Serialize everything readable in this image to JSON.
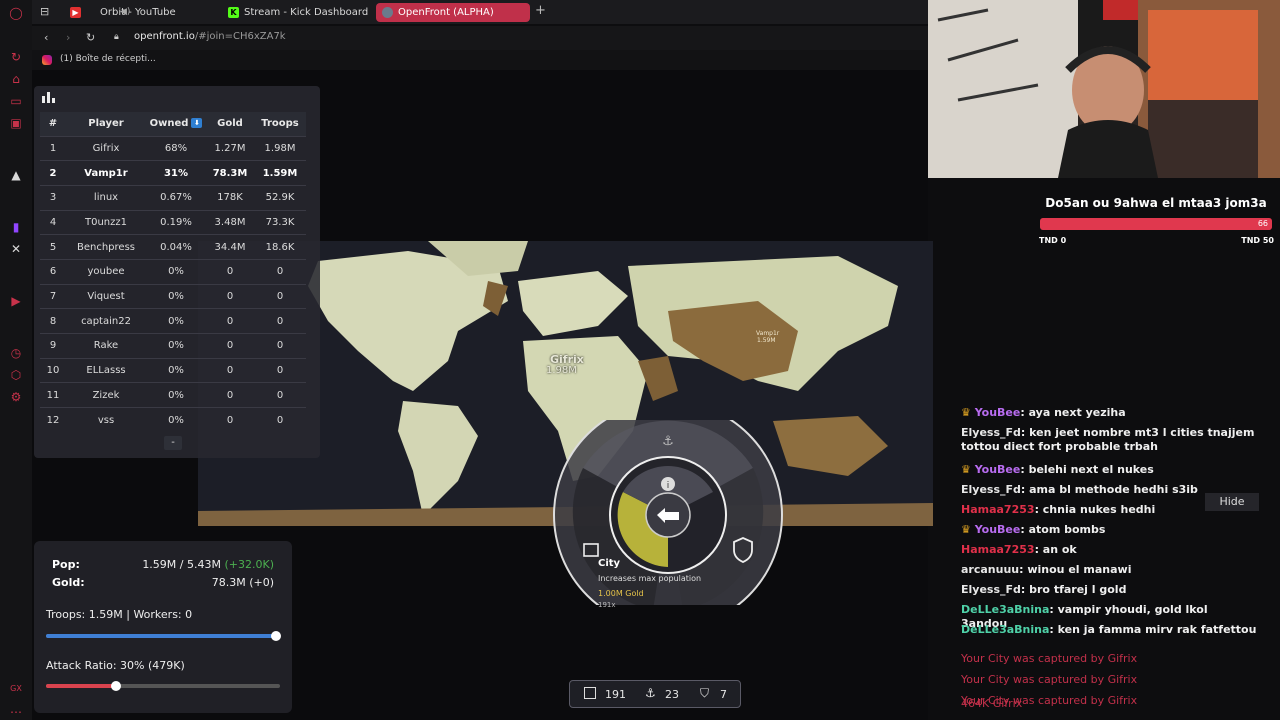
{
  "browser": {
    "tabs": [
      {
        "label": "Orbit - YouTube",
        "icon": "youtube-icon"
      },
      {
        "label": "Stream - Kick Dashboard",
        "icon": "kick-icon"
      },
      {
        "label": "OpenFront (ALPHA)",
        "icon": "globe-icon",
        "active": true
      }
    ],
    "address": "openfront.io/#join=CH6xZA7k",
    "address_host": "openfront.io",
    "address_hash": "/#join=CH6xZA7k",
    "bookmark": "(1) Boîte de récepti..."
  },
  "leaderboard": {
    "headers": [
      "#",
      "Player",
      "Owned",
      "Gold",
      "Troops"
    ],
    "sort_column": "Owned",
    "rows": [
      {
        "rank": "1",
        "player": "Gifrix",
        "owned": "68%",
        "gold": "1.27M",
        "troops": "1.98M"
      },
      {
        "rank": "2",
        "player": "Vamp1r",
        "owned": "31%",
        "gold": "78.3M",
        "troops": "1.59M",
        "me": true
      },
      {
        "rank": "3",
        "player": "linux",
        "owned": "0.67%",
        "gold": "178K",
        "troops": "52.9K"
      },
      {
        "rank": "4",
        "player": "T0unzz1",
        "owned": "0.19%",
        "gold": "3.48M",
        "troops": "73.3K"
      },
      {
        "rank": "5",
        "player": "Benchpress",
        "owned": "0.04%",
        "gold": "34.4M",
        "troops": "18.6K"
      },
      {
        "rank": "6",
        "player": "youbee",
        "owned": "0%",
        "gold": "0",
        "troops": "0"
      },
      {
        "rank": "7",
        "player": "Viquest",
        "owned": "0%",
        "gold": "0",
        "troops": "0"
      },
      {
        "rank": "8",
        "player": "captain22",
        "owned": "0%",
        "gold": "0",
        "troops": "0"
      },
      {
        "rank": "9",
        "player": "Rake",
        "owned": "0%",
        "gold": "0",
        "troops": "0"
      },
      {
        "rank": "10",
        "player": "ELLasss",
        "owned": "0%",
        "gold": "0",
        "troops": "0"
      },
      {
        "rank": "11",
        "player": "Zizek",
        "owned": "0%",
        "gold": "0",
        "troops": "0"
      },
      {
        "rank": "12",
        "player": "vss",
        "owned": "0%",
        "gold": "0",
        "troops": "0"
      }
    ],
    "collapse_label": "-"
  },
  "map_labels": {
    "gifrix_name": "Gifrix",
    "gifrix_troops": "1.98M",
    "vamp_name": "Vamp1r",
    "vamp_troops": "1.59M"
  },
  "stats": {
    "pop_label": "Pop:",
    "pop_value": "1.59M / 5.43M",
    "pop_delta": "(+32.0K)",
    "gold_label": "Gold:",
    "gold_value": "78.3M (+0)",
    "troops_line": "Troops: 1.59M | Workers: 0",
    "troop_ratio": 1.0,
    "attack_line": "Attack Ratio: 30% (479K)",
    "attack_ratio": 0.3,
    "colors": {
      "troop": "#3f7fd4",
      "attack": "#d9434e",
      "delta": "#4caf50"
    }
  },
  "radial_menu": {
    "tooltip_title": "City",
    "tooltip_desc": "Increases max population",
    "tooltip_cost": "1.00M Gold",
    "tooltip_count": "191x"
  },
  "build_bar": {
    "cities": "191",
    "ports": "23",
    "defense": "7"
  },
  "donation": {
    "title": "Do5an ou 9ahwa el mtaa3 jom3a",
    "current": 66,
    "min_label": "TND 0",
    "max_label": "TND 50",
    "bar_value": "66"
  },
  "chat": {
    "hide_label": "Hide",
    "messages": [
      {
        "user": "YouBee",
        "text": ": aya next yeziha",
        "color": "#b86cf0",
        "crown": true
      },
      {
        "user": "Elyess_Fd",
        "text": ": ken jeet nombre mt3 l cities tnajjem tottou diect fort probable trbah",
        "color": "#e8e8e8"
      },
      {
        "user": "YouBee",
        "text": ": belehi next el nukes",
        "color": "#b86cf0",
        "crown": true
      },
      {
        "user": "Elyess_Fd",
        "text": ": ama bl methode hedhi s3ib",
        "color": "#e8e8e8"
      },
      {
        "user": "Hamaa7253",
        "text": ": chnia nukes hedhi",
        "color": "#e0304a"
      },
      {
        "user": "YouBee",
        "text": ": atom bombs",
        "color": "#b86cf0",
        "crown": true
      },
      {
        "user": "Hamaa7253",
        "text": ": an ok",
        "color": "#e0304a"
      },
      {
        "user": "arcanuuu",
        "text": ": winou el manawi",
        "color": "#e8e8e8"
      },
      {
        "user": "Elyess_Fd",
        "text": ": bro tfarej l gold",
        "color": "#e8e8e8"
      },
      {
        "user": "DeLLe3aBnina",
        "text": ": vampir yhoudi, gold lkol 3andou",
        "color": "#4fd1a8"
      },
      {
        "user": "DeLLe3aBnina",
        "text": ": ken ja famma mirv rak fatfettou",
        "color": "#4fd1a8"
      }
    ],
    "game_messages": [
      "Your City was captured by Gifrix",
      "Your City was captured by Gifrix",
      "Your City was captured by Gifrix",
      "464K Gifrix"
    ]
  }
}
